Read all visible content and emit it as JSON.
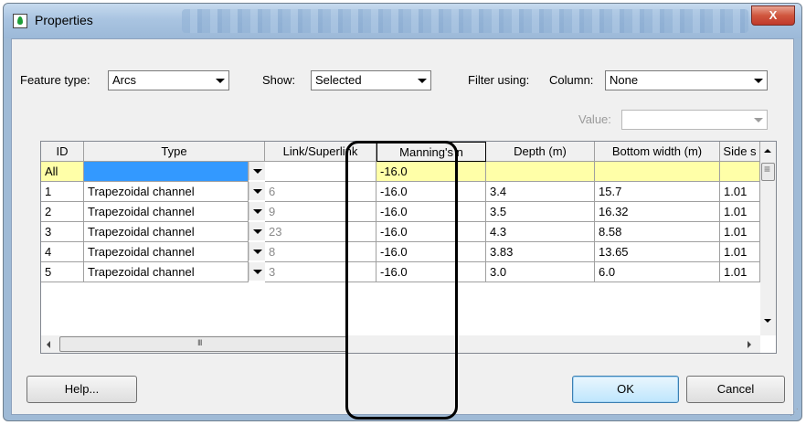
{
  "window": {
    "title": "Properties",
    "close_label": "X"
  },
  "filters": {
    "feature_type_label": "Feature type:",
    "feature_type_value": "Arcs",
    "show_label": "Show:",
    "show_value": "Selected",
    "filter_using_label": "Filter using:",
    "column_label": "Column:",
    "column_value": "None",
    "value_label": "Value:",
    "value_value": ""
  },
  "table": {
    "headers": [
      "ID",
      "Type",
      "Link/Superlink",
      "Manning's n",
      "Depth (m)",
      "Bottom width (m)",
      "Side s"
    ],
    "all_row": {
      "id": "All",
      "type": "",
      "link": "",
      "manning": "-16.0",
      "depth": "",
      "bottom": "",
      "side": ""
    },
    "rows": [
      {
        "id": "1",
        "type": "Trapezoidal channel",
        "link": "6",
        "manning": "-16.0",
        "depth": "3.4",
        "bottom": "15.7",
        "side": "1.01"
      },
      {
        "id": "2",
        "type": "Trapezoidal channel",
        "link": "9",
        "manning": "-16.0",
        "depth": "3.5",
        "bottom": "16.32",
        "side": "1.01"
      },
      {
        "id": "3",
        "type": "Trapezoidal channel",
        "link": "23",
        "manning": "-16.0",
        "depth": "4.3",
        "bottom": "8.58",
        "side": "1.01"
      },
      {
        "id": "4",
        "type": "Trapezoidal channel",
        "link": "8",
        "manning": "-16.0",
        "depth": "3.83",
        "bottom": "13.65",
        "side": "1.01"
      },
      {
        "id": "5",
        "type": "Trapezoidal channel",
        "link": "3",
        "manning": "-16.0",
        "depth": "3.0",
        "bottom": "6.0",
        "side": "1.01"
      }
    ]
  },
  "buttons": {
    "help": "Help...",
    "ok": "OK",
    "cancel": "Cancel"
  },
  "colors": {
    "highlight_yellow": "#ffffa8",
    "selection_blue": "#3399ff"
  }
}
